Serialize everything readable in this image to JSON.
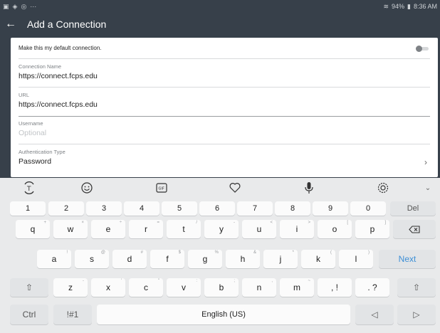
{
  "status_bar": {
    "time": "8:36 AM",
    "battery": "94%",
    "icons_left": [
      "image-icon",
      "shield-icon",
      "circle-icon",
      "dots-icon"
    ]
  },
  "app_bar": {
    "title": "Add a Connection",
    "back_icon": "back-arrow-icon"
  },
  "form": {
    "default_label": "Make this my default connection.",
    "default_toggle_on": false,
    "connection_name": {
      "label": "Connection Name",
      "value": "https://connect.fcps.edu"
    },
    "url": {
      "label": "URL",
      "value": "https://connect.fcps.edu"
    },
    "username": {
      "label": "Username",
      "placeholder": "Optional"
    },
    "auth_type": {
      "label": "Authentication Type",
      "value": "Password"
    }
  },
  "keyboard": {
    "toolbar_icons": [
      "translate-icon",
      "emoji-icon",
      "gif-icon",
      "sticker-icon",
      "microphone-icon",
      "settings-icon",
      "collapse-icon"
    ],
    "number_row": [
      "1",
      "2",
      "3",
      "4",
      "5",
      "6",
      "7",
      "8",
      "9",
      "0",
      "Del"
    ],
    "row1": [
      {
        "k": "q",
        "h": "+"
      },
      {
        "k": "w",
        "h": "×"
      },
      {
        "k": "e",
        "h": "÷"
      },
      {
        "k": "r",
        "h": "="
      },
      {
        "k": "t",
        "h": "/"
      },
      {
        "k": "y",
        "h": "-"
      },
      {
        "k": "u",
        "h": "<"
      },
      {
        "k": "i",
        "h": ">"
      },
      {
        "k": "o",
        "h": "["
      },
      {
        "k": "p",
        "h": "]"
      }
    ],
    "row2": [
      {
        "k": "a",
        "h": "!"
      },
      {
        "k": "s",
        "h": "@"
      },
      {
        "k": "d",
        "h": "#"
      },
      {
        "k": "f",
        "h": "$"
      },
      {
        "k": "g",
        "h": "%"
      },
      {
        "k": "h",
        "h": "&"
      },
      {
        "k": "j",
        "h": "*"
      },
      {
        "k": "k",
        "h": "("
      },
      {
        "k": "l",
        "h": ")"
      }
    ],
    "row3": [
      {
        "k": "z",
        "h": "-"
      },
      {
        "k": "x",
        "h": "'"
      },
      {
        "k": "c",
        "h": "\""
      },
      {
        "k": "v",
        "h": ":"
      },
      {
        "k": "b",
        "h": ";"
      },
      {
        "k": "n",
        "h": ","
      },
      {
        "k": "m",
        "h": "~"
      }
    ],
    "next_label": "Next",
    "ctrl_label": "Ctrl",
    "symbols_label": "!#1",
    "space_label": "English (US)",
    "punct1": ", !",
    "punct2": ". ?"
  }
}
